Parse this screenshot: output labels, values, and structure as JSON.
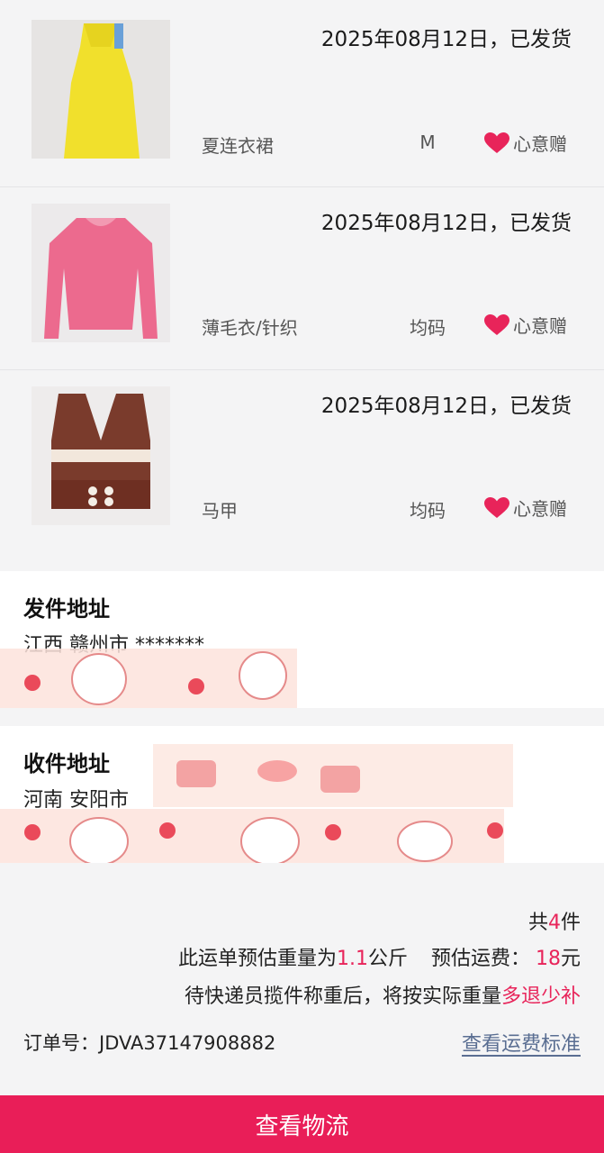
{
  "items": [
    {
      "date": "2025年08月12日，已发货",
      "category": "夏连衣裙",
      "size": "M",
      "gift": "心意赠",
      "thumb_icon": "yellow-dress"
    },
    {
      "date": "2025年08月12日，已发货",
      "category": "薄毛衣/针织",
      "size": "均码",
      "gift": "心意赠",
      "thumb_icon": "pink-knit-sweater"
    },
    {
      "date": "2025年08月12日，已发货",
      "category": "马甲",
      "size": "均码",
      "gift": "心意赠",
      "thumb_icon": "brown-knit-vest"
    }
  ],
  "sender": {
    "title": "发件地址",
    "address": "江西 赣州市 *******"
  },
  "receiver": {
    "title": "收件地址",
    "address": "河南 安阳市"
  },
  "summary": {
    "count_prefix": "共",
    "count": "4",
    "count_suffix": "件",
    "weight_prefix": "此运单预估重量为",
    "weight_value": "1.1",
    "weight_unit": "公斤",
    "fee_label": "预估运费：",
    "fee_value": "18",
    "fee_unit": "元",
    "note_prefix": "待快递员揽件称重后，将按实际重量",
    "note_highlight": "多退少补"
  },
  "order": {
    "label": "订单号：JDVA37147908882",
    "link": "查看运费标准"
  },
  "action": {
    "label": "查看物流"
  },
  "colors": {
    "accent": "#e91e58",
    "link": "#5a6e92",
    "heart": "#e8245a"
  }
}
